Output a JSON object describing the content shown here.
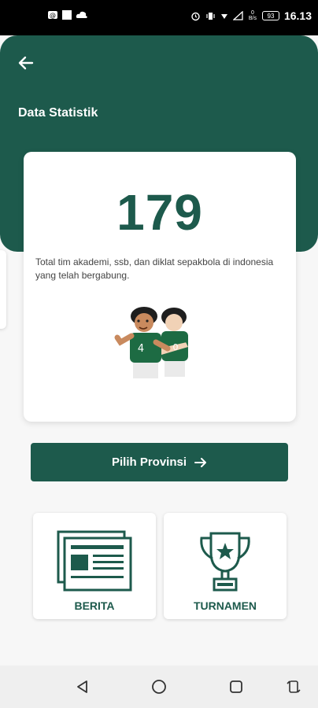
{
  "status_bar": {
    "time": "16.13",
    "icons": [
      "notification-icon",
      "square-icon",
      "cloud-icon",
      "alarm-icon",
      "vibrate-icon",
      "wifi-icon",
      "signal-icon",
      "data-speed-icon",
      "battery-icon"
    ],
    "data_speed": "0 B/s",
    "battery": "93"
  },
  "header": {
    "title": "Data Statistik",
    "bg_color": "#1d5a4c"
  },
  "stat": {
    "number": "179",
    "description": "Total tim akademi, ssb, dan diklat sepakbola di indonesia yang telah bergabung."
  },
  "provinsi_button": {
    "label": "Pilih Provinsi"
  },
  "menu": {
    "berita": {
      "label": "BERITA",
      "icon": "newspaper-icon"
    },
    "turnamen": {
      "label": "TURNAMEN",
      "icon": "trophy-icon"
    }
  },
  "nav_bar": {
    "buttons": [
      "back-triangle-icon",
      "home-circle-icon",
      "recents-square-icon",
      "rotate-icon"
    ]
  },
  "colors": {
    "primary": "#1d5a4c",
    "background": "#f7f7f7"
  }
}
